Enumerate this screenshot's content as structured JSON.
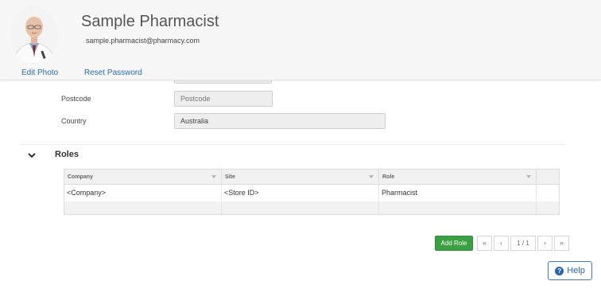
{
  "header": {
    "user_name": "Sample Pharmacist",
    "email": "sample.pharmacist@pharmacy.com",
    "edit_photo": "Edit Photo",
    "reset_password": "Reset Password",
    "avatar_icon": "pharmacist-photo"
  },
  "form": {
    "postcode": {
      "label": "Postcode",
      "value": "",
      "placeholder": "Postcode"
    },
    "country": {
      "label": "Country",
      "value": "Australia"
    }
  },
  "roles": {
    "title": "Roles",
    "columns": [
      "Company",
      "Site",
      "Role"
    ],
    "rows": [
      {
        "company": "<Company>",
        "site": "<Store ID>",
        "role": "Pharmacist"
      }
    ],
    "add_role": "Add Role",
    "pager": {
      "first": "«",
      "prev": "‹",
      "info": "1 / 1",
      "next": "›",
      "last": "»"
    }
  },
  "help": {
    "label": "Help",
    "icon": "question-circle-icon"
  },
  "colors": {
    "accent": "#2a67a8",
    "add_button": "#3aa043",
    "header_bg": "#f7f7f7"
  }
}
